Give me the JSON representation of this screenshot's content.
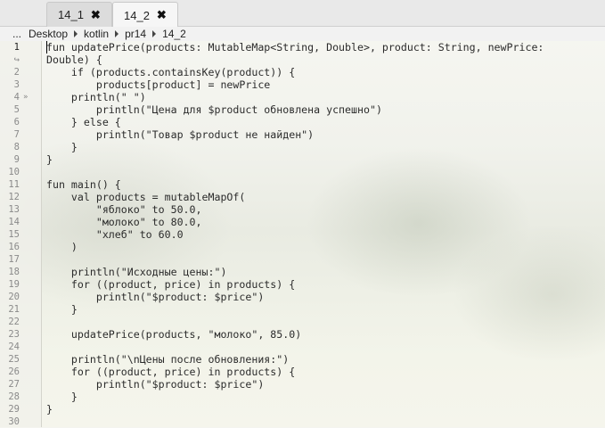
{
  "tabs": [
    {
      "label": "14_1",
      "active": false
    },
    {
      "label": "14_2",
      "active": true
    }
  ],
  "tab_close_glyph": "✖",
  "breadcrumb": {
    "ellipsis": "...",
    "items": [
      "Desktop",
      "kotlin",
      "pr14",
      "14_2"
    ]
  },
  "gutter": {
    "wrap_glyph": "↪",
    "fold_glyph": "»",
    "numbers": [
      "1",
      "",
      "2",
      "3",
      "4",
      "5",
      "6",
      "7",
      "8",
      "9",
      "10",
      "11",
      "12",
      "13",
      "14",
      "15",
      "16",
      "17",
      "18",
      "19",
      "20",
      "21",
      "22",
      "23",
      "24",
      "25",
      "26",
      "27",
      "28",
      "29",
      "30"
    ]
  },
  "code_lines": [
    "fun updatePrice(products: MutableMap<String, Double>, product: String, newPrice:",
    "Double) {",
    "    if (products.containsKey(product)) {",
    "        products[product] = newPrice",
    "    println(\" \")",
    "        println(\"Цена для $product обновлена успешно\")",
    "    } else {",
    "        println(\"Товар $product не найден\")",
    "    }",
    "}",
    "",
    "fun main() {",
    "    val products = mutableMapOf(",
    "        \"яблоко\" to 50.0,",
    "        \"молоко\" to 80.0,",
    "        \"хлеб\" to 60.0",
    "    )",
    "",
    "    println(\"Исходные цены:\")",
    "    for ((product, price) in products) {",
    "        println(\"$product: $price\")",
    "    }",
    "",
    "    updatePrice(products, \"молоко\", 85.0)",
    "",
    "    println(\"\\nЦены после обновления:\")",
    "    for ((product, price) in products) {",
    "        println(\"$product: $price\")",
    "    }",
    "}",
    ""
  ]
}
